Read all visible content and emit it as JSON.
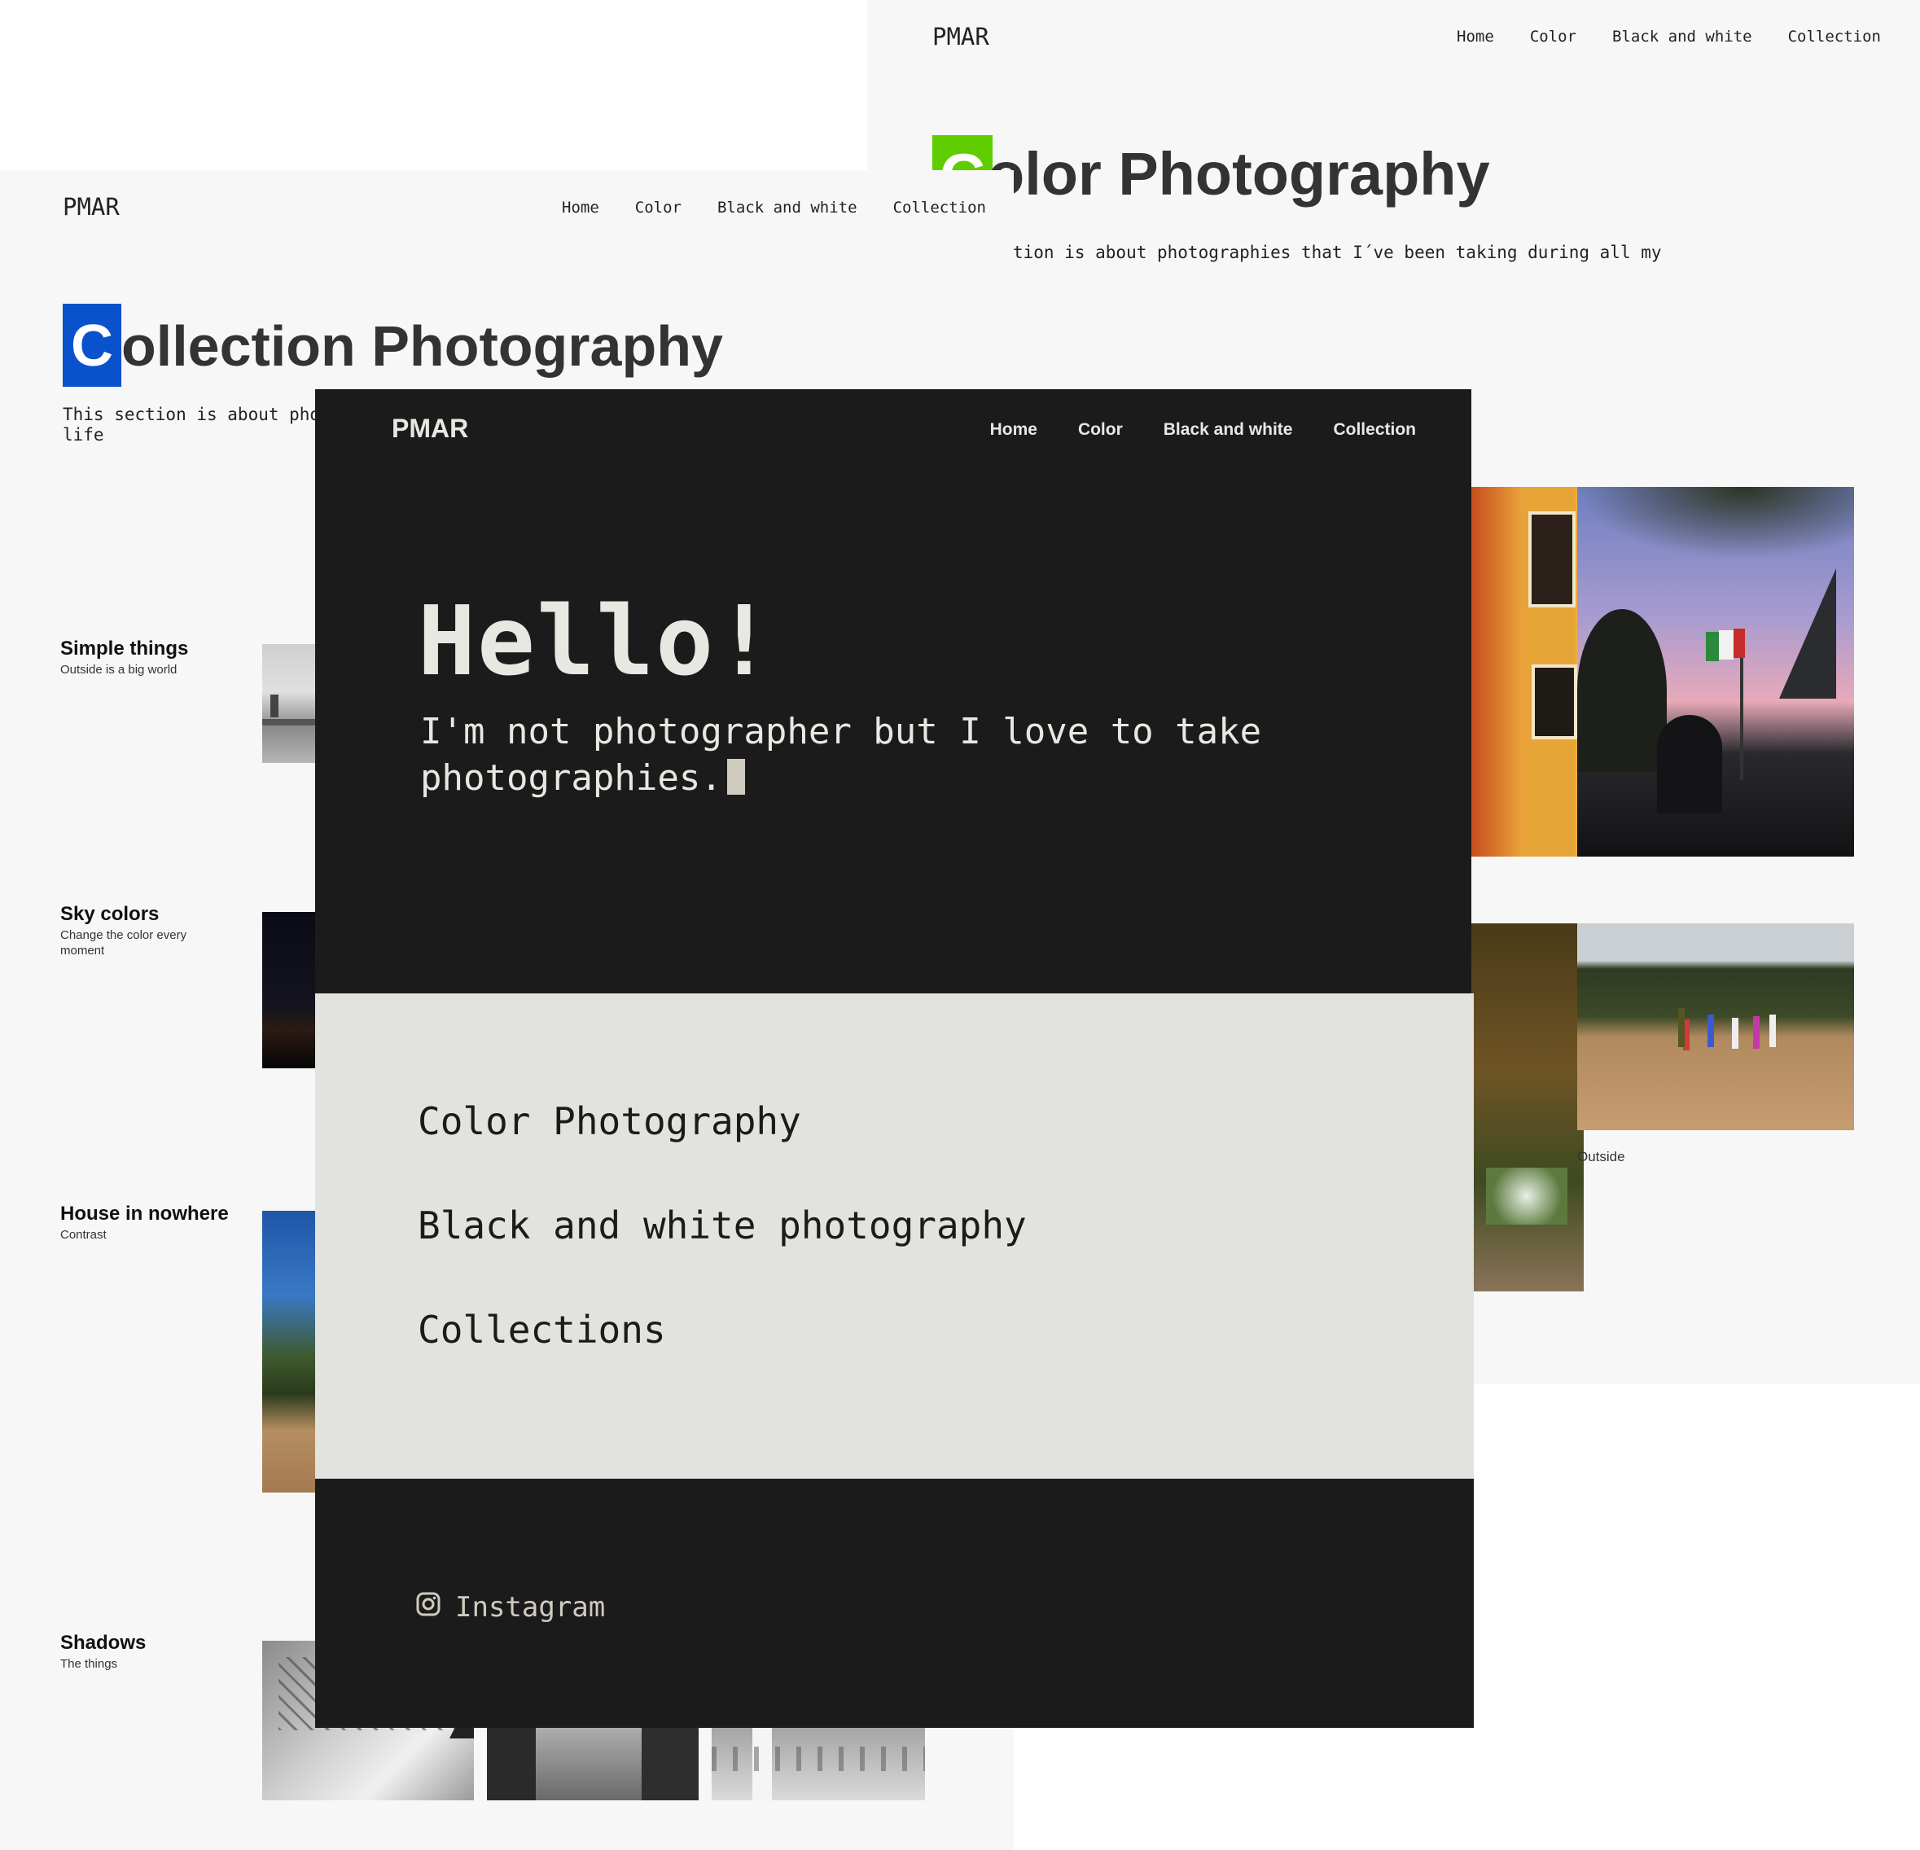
{
  "color_page": {
    "brand": "PMAR",
    "nav": [
      "Home",
      "Color",
      "Black and white",
      "Collection"
    ],
    "title_initial": "C",
    "title_rest": "olor Photography",
    "description": "tion is about photographies that I´ve been taking during all my",
    "accent_color": "#5fcd00",
    "caption": "Outside"
  },
  "collection_page": {
    "brand": "PMAR",
    "nav": [
      "Home",
      "Color",
      "Black and white",
      "Collection"
    ],
    "title_initial": "C",
    "title_rest": "ollection Photography",
    "description_line1": "This section is about phot",
    "description_line2": "life",
    "accent_color": "#0a52cc",
    "items": [
      {
        "title": "Simple things",
        "subtitle": "Outside is a big world"
      },
      {
        "title": "Sky colors",
        "subtitle": "Change the color every moment"
      },
      {
        "title": "House in nowhere",
        "subtitle": "Contrast"
      },
      {
        "title": "Shadows",
        "subtitle": "The things"
      }
    ]
  },
  "home_page": {
    "brand": "PMAR",
    "nav": [
      "Home",
      "Color",
      "Black and white",
      "Collection"
    ],
    "heading": "Hello!",
    "intro": "I'm not photographer but I love to take photographies.",
    "links": [
      "Color Photography",
      "Black and white photography",
      "Collections"
    ],
    "footer_link": "Instagram",
    "icon": "instagram-icon"
  }
}
